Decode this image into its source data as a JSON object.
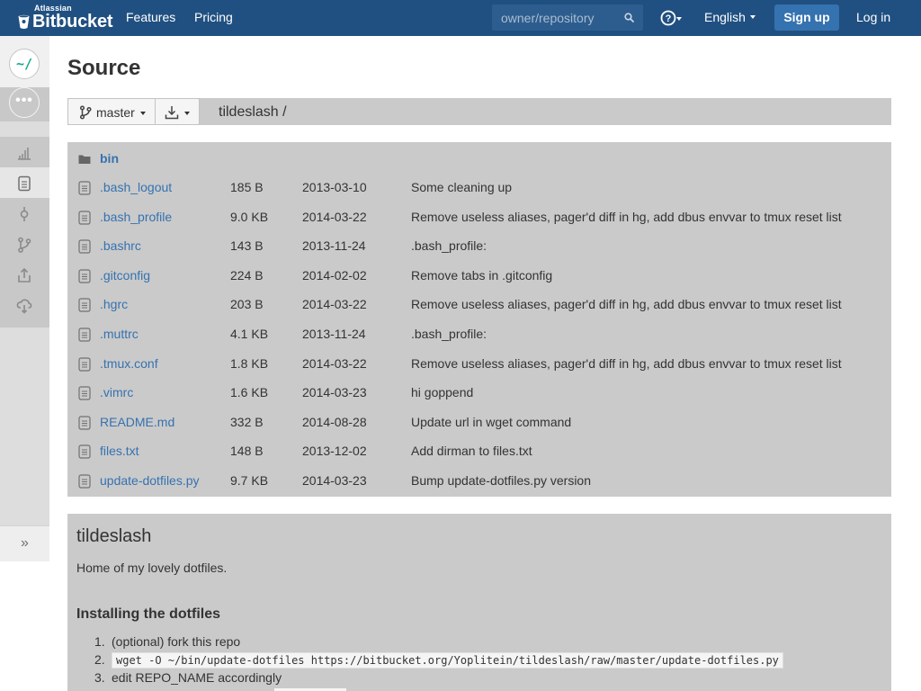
{
  "header": {
    "brand_small": "Atlassian",
    "brand": "Bitbucket",
    "nav": [
      "Features",
      "Pricing"
    ],
    "search_placeholder": "owner/repository",
    "language": "English",
    "signup_label": "Sign up",
    "login_label": "Log in",
    "color": "#205081"
  },
  "sidebar": {
    "repo_avatar_text": "~/",
    "items": [
      "overview-icon",
      "source-icon",
      "commits-icon",
      "branches-icon",
      "pull-requests-icon",
      "downloads-icon"
    ],
    "active_item": "source-icon",
    "collapse_label": "»"
  },
  "page": {
    "title": "Source",
    "branch": "master",
    "path": "tildeslash /"
  },
  "files": [
    {
      "type": "dir",
      "name": "bin",
      "size": "",
      "date": "",
      "message": ""
    },
    {
      "type": "file",
      "name": ".bash_logout",
      "size": "185 B",
      "date": "2013-03-10",
      "message": "Some cleaning up"
    },
    {
      "type": "file",
      "name": ".bash_profile",
      "size": "9.0 KB",
      "date": "2014-03-22",
      "message": "Remove useless aliases, pager'd diff in hg, add dbus envvar to tmux reset list"
    },
    {
      "type": "file",
      "name": ".bashrc",
      "size": "143 B",
      "date": "2013-11-24",
      "message": ".bash_profile:"
    },
    {
      "type": "file",
      "name": ".gitconfig",
      "size": "224 B",
      "date": "2014-02-02",
      "message": "Remove tabs in .gitconfig"
    },
    {
      "type": "file",
      "name": ".hgrc",
      "size": "203 B",
      "date": "2014-03-22",
      "message": "Remove useless aliases, pager'd diff in hg, add dbus envvar to tmux reset list"
    },
    {
      "type": "file",
      "name": ".muttrc",
      "size": "4.1 KB",
      "date": "2013-11-24",
      "message": ".bash_profile:"
    },
    {
      "type": "file",
      "name": ".tmux.conf",
      "size": "1.8 KB",
      "date": "2014-03-22",
      "message": "Remove useless aliases, pager'd diff in hg, add dbus envvar to tmux reset list"
    },
    {
      "type": "file",
      "name": ".vimrc",
      "size": "1.6 KB",
      "date": "2014-03-23",
      "message": "hi goppend"
    },
    {
      "type": "file",
      "name": "README.md",
      "size": "332 B",
      "date": "2014-08-28",
      "message": "Update url in wget command"
    },
    {
      "type": "file",
      "name": "files.txt",
      "size": "148 B",
      "date": "2013-12-02",
      "message": "Add dirman to files.txt"
    },
    {
      "type": "file",
      "name": "update-dotfiles.py",
      "size": "9.7 KB",
      "date": "2014-03-23",
      "message": "Bump update-dotfiles.py version"
    }
  ],
  "readme": {
    "title": "tildeslash",
    "description": "Home of my lovely dotfiles.",
    "section_title": "Installing the dotfiles",
    "steps": [
      {
        "num": "1.",
        "text": "(optional) fork this repo",
        "code": ""
      },
      {
        "num": "2.",
        "text": "",
        "code": "wget -O ~/bin/update-dotfiles https://bitbucket.org/Yoplitein/tildeslash/raw/master/update-dotfiles.py"
      },
      {
        "num": "3.",
        "text": "edit REPO_NAME accordingly",
        "code": ""
      }
    ]
  }
}
